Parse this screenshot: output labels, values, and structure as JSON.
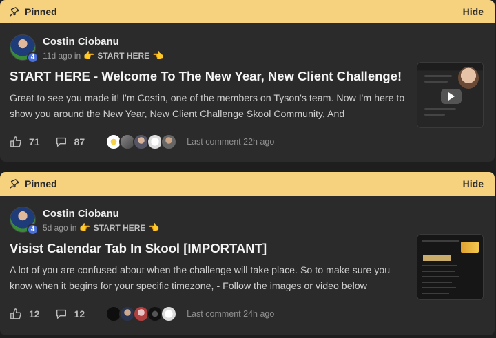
{
  "posts": [
    {
      "pinned_label": "Pinned",
      "hide_label": "Hide",
      "author": "Costin Ciobanu",
      "level": "4",
      "time": "11d ago in",
      "category": "START HERE",
      "title": "START HERE - Welcome To The New Year, New Client Challenge!",
      "excerpt": "Great to see you made it! I'm Costin, one of the members on Tyson's team. Now I'm here to show you around the New Year, New Client Challenge Skool Community, And",
      "likes": "71",
      "comments": "87",
      "last_comment": "Last comment 22h ago",
      "thumbnail": "video"
    },
    {
      "pinned_label": "Pinned",
      "hide_label": "Hide",
      "author": "Costin Ciobanu",
      "level": "4",
      "time": "5d ago in",
      "category": "START HERE",
      "title": "Visist Calendar Tab In Skool [IMPORTANT]",
      "excerpt": "A lot of you are confused about when the challenge will take place. So to make sure you know when it begins for your specific timezone, - Follow the images or video below",
      "likes": "12",
      "comments": "12",
      "last_comment": "Last comment 24h ago",
      "thumbnail": "screenshot"
    }
  ],
  "colors": {
    "pin_bar": "#f6d27f",
    "card": "#2b2b2b",
    "background": "#1e1e1e",
    "level_badge": "#4a6fd6"
  }
}
